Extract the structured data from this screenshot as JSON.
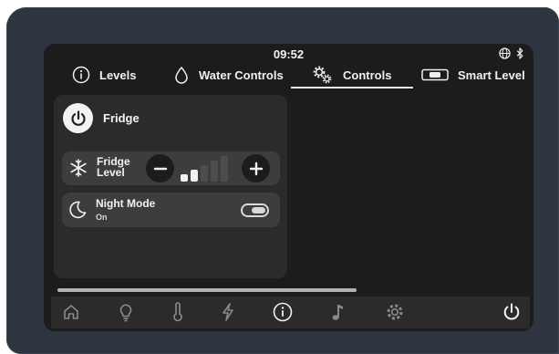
{
  "status_bar": {
    "time": "09:52",
    "icons": [
      "globe-icon",
      "bluetooth-icon"
    ]
  },
  "tabs": [
    {
      "label": "Levels",
      "icon": "info-icon",
      "active": false
    },
    {
      "label": "Water Controls",
      "icon": "water-drop-icon",
      "active": false
    },
    {
      "label": "Controls",
      "icon": "gears-icon",
      "active": true
    },
    {
      "label": "Smart Level",
      "icon": "level-gauge-icon",
      "active": false
    }
  ],
  "fridge_card": {
    "title": "Fridge",
    "level_row": {
      "label": "Fridge Level",
      "label_line1": "Fridge",
      "label_line2": "Level",
      "level": 2,
      "max_level": 5
    },
    "night_mode_row": {
      "label": "Night Mode",
      "status": "On",
      "enabled": true
    }
  },
  "bottom_nav": [
    "home-icon",
    "lightbulb-icon",
    "thermometer-icon",
    "lightning-icon",
    "info-icon",
    "music-note-icon",
    "settings-gear-icon",
    "power-icon"
  ],
  "colors": {
    "background": "#1c1c1c",
    "card": "#2b2b2b",
    "row": "#3d3d3d",
    "text": "#f2f2f2",
    "bar_active": "#f2f2f2",
    "bar_inactive": "#4d4d4d",
    "bezel": "#2e3440"
  }
}
